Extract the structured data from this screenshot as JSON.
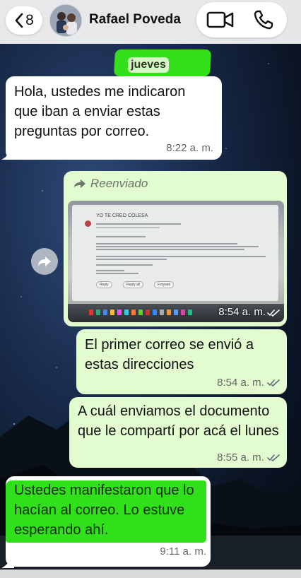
{
  "header": {
    "back_count": "8",
    "contact_name": "Rafael Poveda"
  },
  "day_chip": "jueves",
  "messages": [
    {
      "direction": "in",
      "text": "Hola, ustedes me indicaron que iban a enviar estas preguntas por correo.",
      "time": "8:22 a. m."
    },
    {
      "direction": "out",
      "forwarded_label": "Reenviado",
      "type": "image",
      "image_caption_lines": {
        "title": "YO TE CREO COLESA",
        "btn_reply": "Reply",
        "btn_reply_all": "Reply all",
        "btn_forward": "Forward"
      },
      "time": "8:54 a. m."
    },
    {
      "direction": "out",
      "text": "El primer correo se envió a estas direcciones",
      "time": "8:54 a. m."
    },
    {
      "direction": "out",
      "text": "A cuál enviamos el documento que le compartí por acá el lunes",
      "time": "8:55 a. m."
    },
    {
      "direction": "out",
      "text": "Ustedes manifestaron que lo hacían al correo. Lo estuve esperando ahí.",
      "time": "9:11 a. m."
    }
  ],
  "colors": {
    "incoming_bubble": "#ffffff",
    "outgoing_bubble": "#e2fbcf",
    "highlight": "#2fe01b",
    "read_check": "#5b6b78"
  },
  "icons": {
    "back": "chevron-left-icon",
    "video": "video-call-icon",
    "phone": "phone-icon",
    "forward": "forward-arrow-icon",
    "share": "share-icon"
  }
}
